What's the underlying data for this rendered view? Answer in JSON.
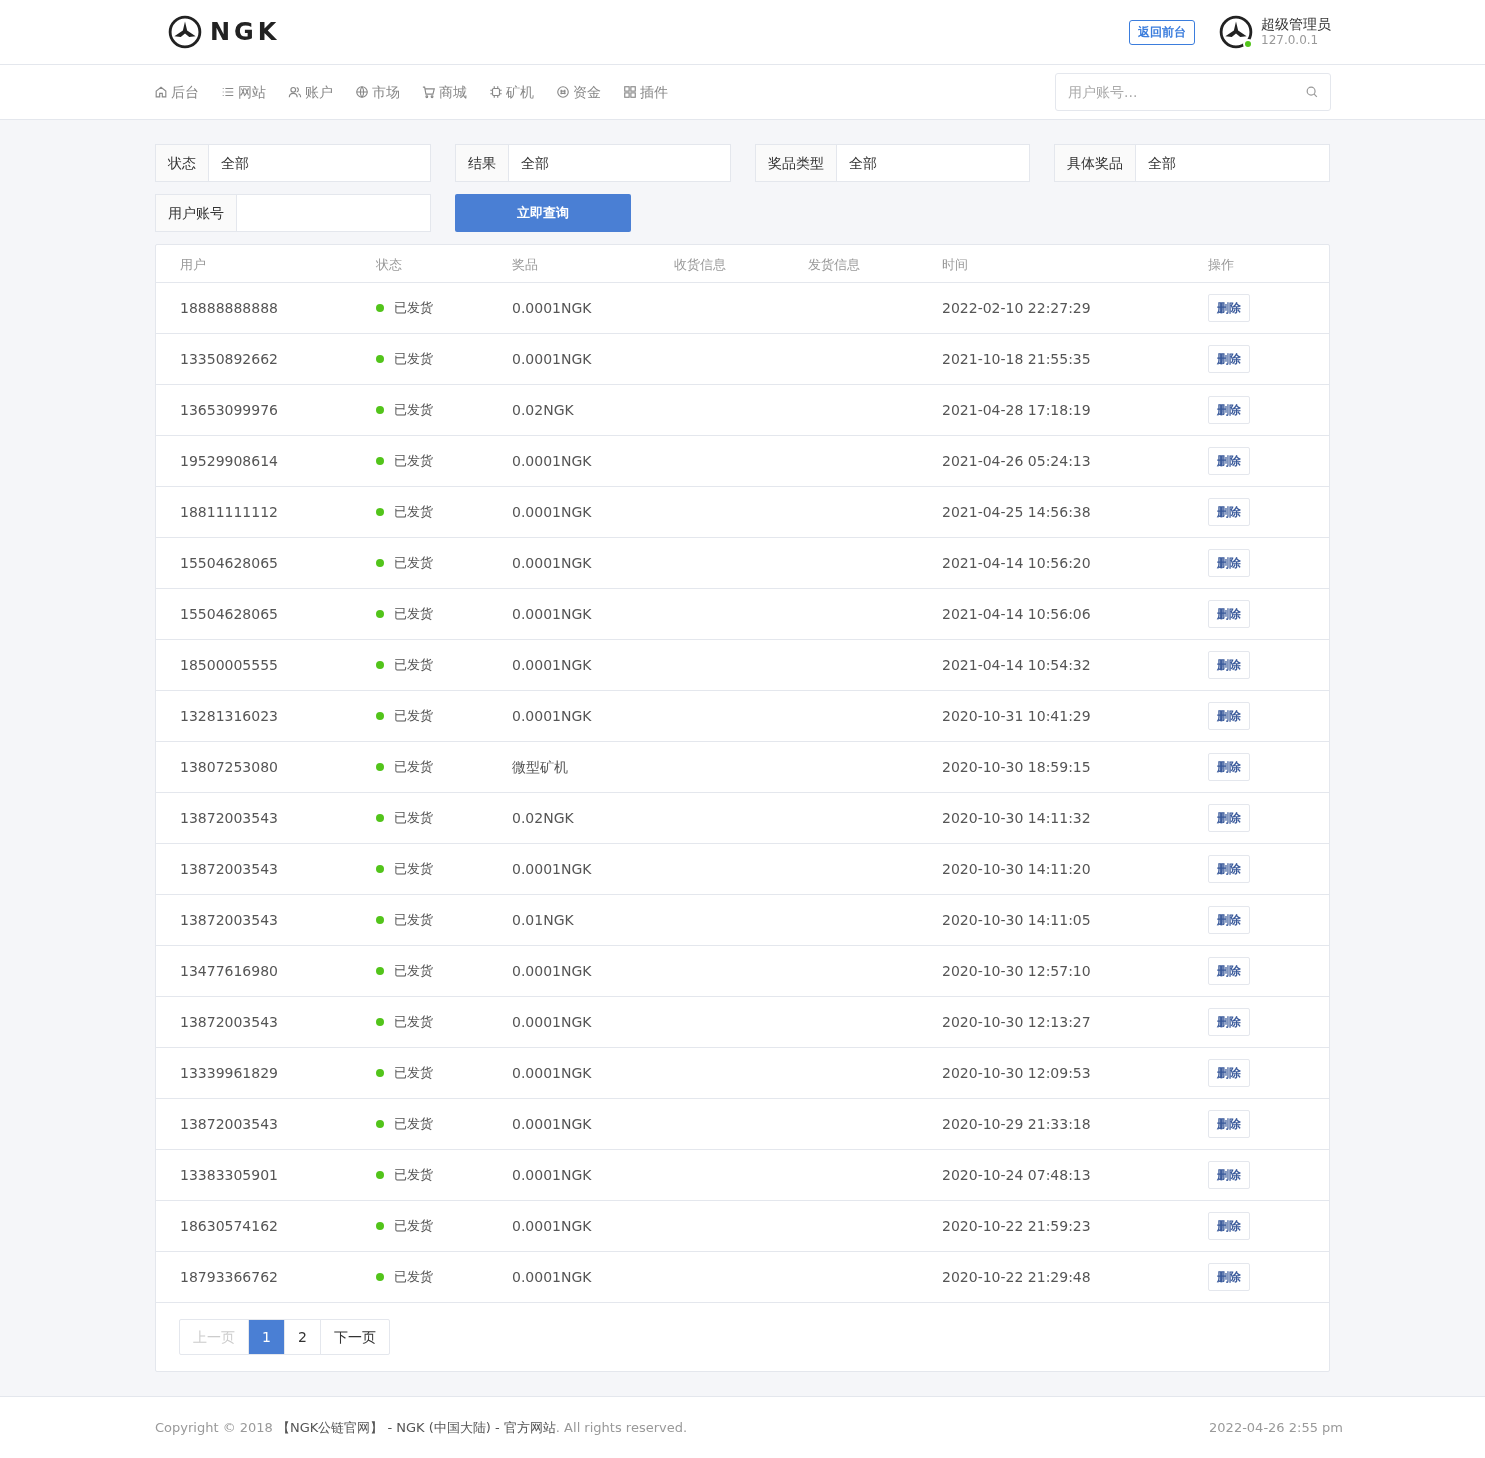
{
  "header": {
    "logo_text": "NGK",
    "back_button": "返回前台",
    "user": {
      "name": "超级管理员",
      "ip": "127.0.0.1",
      "online": true
    }
  },
  "nav": {
    "items": [
      {
        "label": "后台"
      },
      {
        "label": "网站"
      },
      {
        "label": "账户"
      },
      {
        "label": "市场"
      },
      {
        "label": "商城"
      },
      {
        "label": "矿机"
      },
      {
        "label": "资金"
      },
      {
        "label": "插件"
      }
    ],
    "search_placeholder": "用户账号..."
  },
  "filters": [
    {
      "label": "状态",
      "value": "全部"
    },
    {
      "label": "结果",
      "value": "全部"
    },
    {
      "label": "奖品类型",
      "value": "全部"
    },
    {
      "label": "具体奖品",
      "value": "全部"
    }
  ],
  "account_filter": {
    "label": "用户账号"
  },
  "query_button": "立即查询",
  "table": {
    "columns": [
      "用户",
      "状态",
      "奖品",
      "收货信息",
      "发货信息",
      "时间",
      "操作"
    ],
    "rows": [
      {
        "user": "18888888888",
        "status": "已发货",
        "prize": "0.0001NGK",
        "time": "2022-02-10 22:27:29",
        "action": "删除"
      },
      {
        "user": "13350892662",
        "status": "已发货",
        "prize": "0.0001NGK",
        "time": "2021-10-18 21:55:35",
        "action": "删除"
      },
      {
        "user": "13653099976",
        "status": "已发货",
        "prize": "0.02NGK",
        "time": "2021-04-28 17:18:19",
        "action": "删除"
      },
      {
        "user": "19529908614",
        "status": "已发货",
        "prize": "0.0001NGK",
        "time": "2021-04-26 05:24:13",
        "action": "删除"
      },
      {
        "user": "18811111112",
        "status": "已发货",
        "prize": "0.0001NGK",
        "time": "2021-04-25 14:56:38",
        "action": "删除"
      },
      {
        "user": "15504628065",
        "status": "已发货",
        "prize": "0.0001NGK",
        "time": "2021-04-14 10:56:20",
        "action": "删除"
      },
      {
        "user": "15504628065",
        "status": "已发货",
        "prize": "0.0001NGK",
        "time": "2021-04-14 10:56:06",
        "action": "删除"
      },
      {
        "user": "18500005555",
        "status": "已发货",
        "prize": "0.0001NGK",
        "time": "2021-04-14 10:54:32",
        "action": "删除"
      },
      {
        "user": "13281316023",
        "status": "已发货",
        "prize": "0.0001NGK",
        "time": "2020-10-31 10:41:29",
        "action": "删除"
      },
      {
        "user": "13807253080",
        "status": "已发货",
        "prize": "微型矿机",
        "time": "2020-10-30 18:59:15",
        "action": "删除"
      },
      {
        "user": "13872003543",
        "status": "已发货",
        "prize": "0.02NGK",
        "time": "2020-10-30 14:11:32",
        "action": "删除"
      },
      {
        "user": "13872003543",
        "status": "已发货",
        "prize": "0.0001NGK",
        "time": "2020-10-30 14:11:20",
        "action": "删除"
      },
      {
        "user": "13872003543",
        "status": "已发货",
        "prize": "0.01NGK",
        "time": "2020-10-30 14:11:05",
        "action": "删除"
      },
      {
        "user": "13477616980",
        "status": "已发货",
        "prize": "0.0001NGK",
        "time": "2020-10-30 12:57:10",
        "action": "删除"
      },
      {
        "user": "13872003543",
        "status": "已发货",
        "prize": "0.0001NGK",
        "time": "2020-10-30 12:13:27",
        "action": "删除"
      },
      {
        "user": "13339961829",
        "status": "已发货",
        "prize": "0.0001NGK",
        "time": "2020-10-30 12:09:53",
        "action": "删除"
      },
      {
        "user": "13872003543",
        "status": "已发货",
        "prize": "0.0001NGK",
        "time": "2020-10-29 21:33:18",
        "action": "删除"
      },
      {
        "user": "13383305901",
        "status": "已发货",
        "prize": "0.0001NGK",
        "time": "2020-10-24 07:48:13",
        "action": "删除"
      },
      {
        "user": "18630574162",
        "status": "已发货",
        "prize": "0.0001NGK",
        "time": "2020-10-22 21:59:23",
        "action": "删除"
      },
      {
        "user": "18793366762",
        "status": "已发货",
        "prize": "0.0001NGK",
        "time": "2020-10-22 21:29:48",
        "action": "删除"
      }
    ]
  },
  "pagination": [
    {
      "label": "上一页",
      "kind": "prev",
      "disabled": true
    },
    {
      "label": "1",
      "kind": "page",
      "selected": true
    },
    {
      "label": "2",
      "kind": "page",
      "selected": false
    },
    {
      "label": "下一页",
      "kind": "next",
      "disabled": false
    }
  ],
  "footer": {
    "prefix": "Copyright © 2018 ",
    "link": "【NGK公链官网】 - NGK (中国大陆) - 官方网站",
    "suffix": ". All rights reserved.",
    "date": "2022-04-26 2:55 pm"
  }
}
